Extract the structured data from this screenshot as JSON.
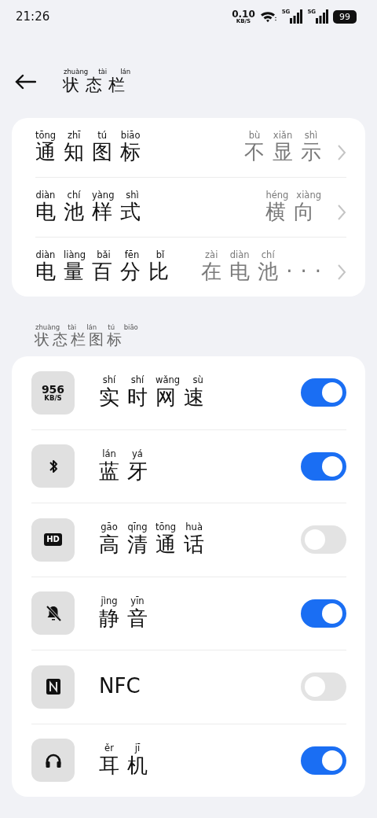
{
  "status_bar": {
    "time": "21:26",
    "net_speed": "0.10",
    "net_speed_unit": "KB/S",
    "sim_1": "5G",
    "sim_2": "5G",
    "battery": "99"
  },
  "header": {
    "title": "状态栏",
    "pinyin": "zhuàng tài lán"
  },
  "settings": [
    {
      "label": "通知图标",
      "pinyin": "tōng zhī tú biāo",
      "value": "不显示",
      "value_pinyin": "bù xiǎn shì"
    },
    {
      "label": "电池样式",
      "pinyin": "diàn chí yàng shì",
      "value": "横向",
      "value_pinyin": "héng xiàng"
    },
    {
      "label": "电量百分比",
      "pinyin": "diàn liàng bǎi fēn bǐ",
      "value": "在电池···",
      "value_pinyin": "zài diàn chí"
    }
  ],
  "section_title": {
    "title": "状态栏图标",
    "pinyin": "zhuàng tài lán tú biāo"
  },
  "icons": [
    {
      "kind": "speed",
      "speed": "956",
      "unit": "KB/S",
      "label": "实时网速",
      "pinyin": "shí shí wǎng sù",
      "on": true
    },
    {
      "kind": "bluetooth",
      "label": "蓝牙",
      "pinyin": "lán yá",
      "on": true
    },
    {
      "kind": "hd",
      "badge": "HD",
      "label": "高清通话",
      "pinyin": "gāo qīng tōng huà",
      "on": false
    },
    {
      "kind": "mute",
      "label": "静音",
      "pinyin": "jìng yīn",
      "on": true
    },
    {
      "kind": "nfc",
      "label": "NFC",
      "on": false
    },
    {
      "kind": "headphones",
      "label": "耳机",
      "pinyin": "ěr jī",
      "on": true
    }
  ]
}
